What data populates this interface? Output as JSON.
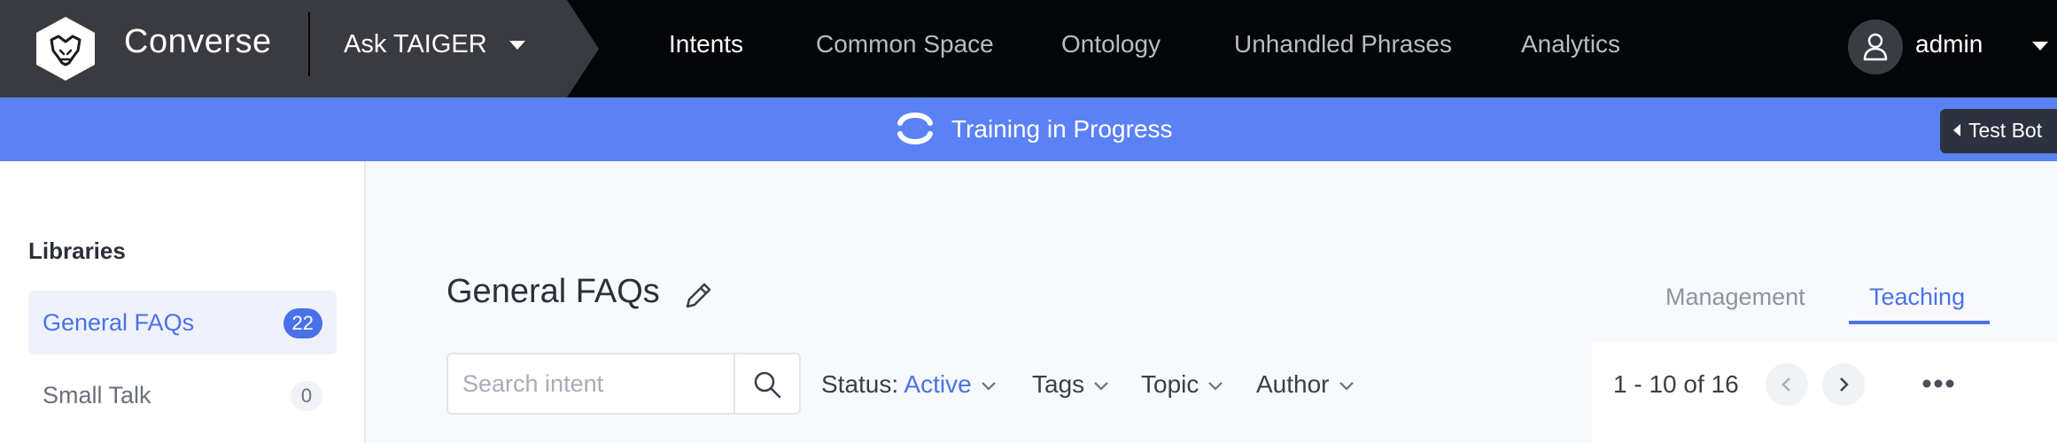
{
  "header": {
    "brand": "Converse",
    "bot_selector": "Ask TAIGER",
    "nav": [
      {
        "label": "Intents",
        "active": true
      },
      {
        "label": "Common Space",
        "active": false
      },
      {
        "label": "Ontology",
        "active": false
      },
      {
        "label": "Unhandled Phrases",
        "active": false
      },
      {
        "label": "Analytics",
        "active": false
      }
    ],
    "user": "admin"
  },
  "banner": {
    "text": "Training in Progress",
    "test_bot": "Test Bot"
  },
  "sidebar": {
    "title": "Libraries",
    "libraries": [
      {
        "label": "General FAQs",
        "count": "22",
        "active": true
      },
      {
        "label": "Small Talk",
        "count": "0",
        "active": false
      }
    ]
  },
  "main": {
    "title": "General FAQs",
    "tabs": [
      {
        "label": "Management",
        "active": false
      },
      {
        "label": "Teaching",
        "active": true
      }
    ],
    "search": {
      "placeholder": "Search intent",
      "value": ""
    },
    "filters": {
      "status_label": "Status:",
      "status_value": "Active",
      "tags": "Tags",
      "topic": "Topic",
      "author": "Author"
    },
    "pagination": "1 - 10 of 16"
  },
  "colors": {
    "nav_bg": "#040508",
    "brand_bg": "#3a3b40",
    "banner": "#5b82f4",
    "accent": "#4a72e8"
  },
  "icons": [
    "lion-logo-icon",
    "chevron-down-icon",
    "user-icon",
    "sync-icon",
    "caret-left-icon",
    "pencil-icon",
    "search-icon",
    "chevron-left-icon",
    "chevron-right-icon",
    "more-horizontal-icon"
  ]
}
